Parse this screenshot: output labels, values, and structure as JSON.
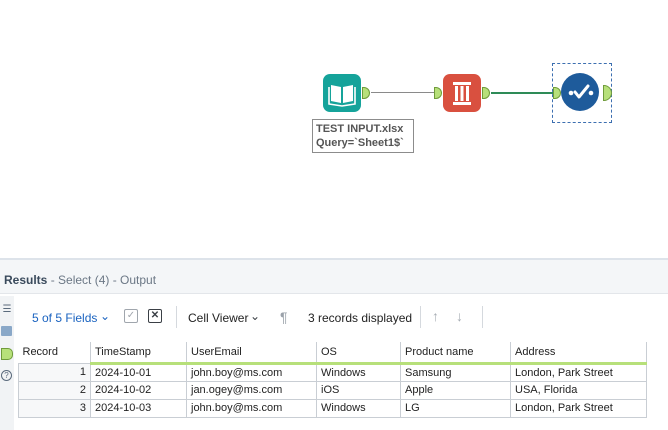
{
  "canvas": {
    "tools": [
      {
        "name": "input-data-tool",
        "icon": "book-icon"
      },
      {
        "name": "select-tool",
        "icon": "column-icon"
      },
      {
        "name": "browse-tool",
        "icon": "checkmark-icon"
      }
    ],
    "annotation": {
      "line1": "TEST INPUT.xlsx",
      "line2": "Query=`Sheet1$`"
    },
    "colors": {
      "input_tool": "#15a39a",
      "select_tool": "#d9503f",
      "browse_tool": "#1e5b9b",
      "anchor": "#b7e07a"
    }
  },
  "results": {
    "title": "Results",
    "subtitle": " - Select (4) - Output",
    "toolbar": {
      "fields_label": "5 of 5 Fields",
      "cell_viewer_label": "Cell Viewer",
      "records_label": "3 records displayed"
    },
    "columns": [
      "Record",
      "TimeStamp",
      "UserEmail",
      "OS",
      "Product name",
      "Address"
    ],
    "rows": [
      [
        "1",
        "2024-10-01",
        "john.boy@ms.com",
        "Windows",
        "Samsung",
        "London, Park Street"
      ],
      [
        "2",
        "2024-10-02",
        "jan.ogey@ms.com",
        "iOS",
        "Apple",
        "USA, Florida"
      ],
      [
        "3",
        "2024-10-03",
        "john.boy@ms.com",
        "Windows",
        "LG",
        "London, Park Street"
      ]
    ]
  }
}
